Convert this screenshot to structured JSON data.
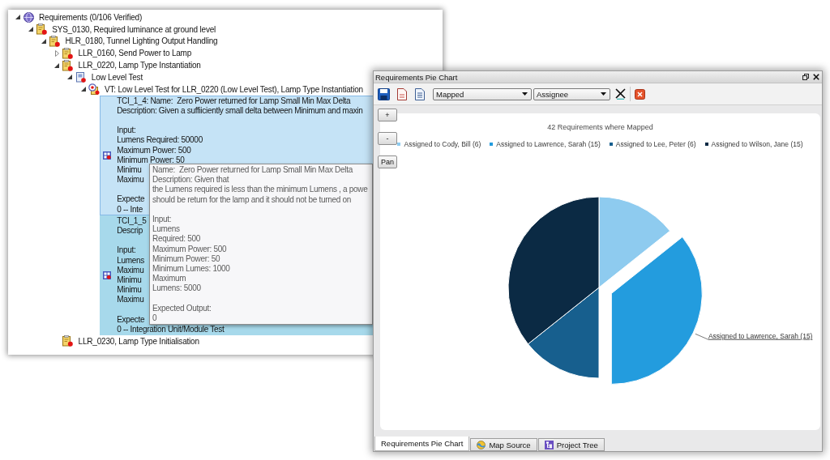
{
  "tree_window": {
    "tree": [
      {
        "label": "Requirements (0/106 Verified)",
        "kind": "root",
        "expanded": true,
        "selected": false,
        "children": [
          {
            "label": "SYS_0130, Required luminance at ground level",
            "kind": "requirement",
            "expanded": true,
            "selected": false,
            "children": [
              {
                "label": "HLR_0180, Tunnel Lighting Output Handling",
                "kind": "requirement",
                "expanded": true,
                "selected": false,
                "children": [
                  {
                    "label": "LLR_0160, Send Power to Lamp",
                    "kind": "requirement",
                    "expanded": false,
                    "selected": false
                  },
                  {
                    "label": "LLR_0220, Lamp Type Instantiation",
                    "kind": "requirement",
                    "expanded": true,
                    "selected": false,
                    "children": [
                      {
                        "label": "Low Level Test",
                        "kind": "test-group",
                        "expanded": true,
                        "selected": false,
                        "children": [
                          {
                            "label": "VT: Low Level Test for LLR_0220 (Low Level Test), Lamp Type Instantiation",
                            "kind": "verification",
                            "expanded": true,
                            "selected": false,
                            "children": [
                              {
                                "kind": "test-case",
                                "selected": false,
                                "hovered": true,
                                "paragraphs": [
                                  [
                                    "TCI_1_4: Name:  Zero Power returned for Lamp Small Min Max Delta",
                                    "Description: Given a suffiiciently small delta between Minimum and maxin"
                                  ],
                                  [
                                    "Input:",
                                    "Lumens Required: 50000",
                                    "Maximum Power: 500",
                                    "Minimum Power: 50",
                                    "Minimu",
                                    "Maximu"
                                  ],
                                  [
                                    "Expecte",
                                    "0 -- Inte"
                                  ]
                                ]
                              },
                              {
                                "kind": "test-case",
                                "selected": true,
                                "hovered": false,
                                "paragraphs": [
                                  [
                                    "TCI_1_5",
                                    "Descrip"
                                  ],
                                  [
                                    "Input:",
                                    "Lumens",
                                    "Maximu",
                                    "Minimu",
                                    "Minimu",
                                    "Maximu"
                                  ],
                                  [
                                    "Expecte",
                                    "0 -- Integration Unit/Module Test"
                                  ]
                                ]
                              }
                            ]
                          }
                        ]
                      }
                    ]
                  },
                  {
                    "label": "LLR_0230, Lamp Type Initialisation",
                    "kind": "requirement",
                    "selected": false
                  }
                ]
              }
            ]
          }
        ]
      }
    ]
  },
  "tooltip": {
    "paragraphs": [
      [
        "Name:  Zero Power returned for Lamp Small Min Max Delta",
        "Description: Given that",
        "the Lumens required is less than the minimum Lumens , a powe",
        "should be return for the lamp and it should not be turned on"
      ],
      [
        "Input:",
        "Lumens",
        "Required: 500",
        "Maximum Power: 500",
        "Minimum Power: 50",
        "Minimum Lumes: 1000",
        "Maximum",
        "Lumens: 5000"
      ],
      [
        "Expected Output:",
        "0"
      ]
    ]
  },
  "chart_window": {
    "title": "Requirements Pie Chart",
    "filters": [
      {
        "value": "Mapped"
      },
      {
        "value": "Assignee"
      }
    ],
    "tool_buttons": [
      {
        "label": "+"
      },
      {
        "label": "-"
      },
      {
        "label": "Pan"
      }
    ],
    "chart": {
      "slices": [
        {
          "color": "#8ecbef",
          "exploded": false
        },
        {
          "color": "#239cde",
          "exploded": true,
          "label": "Assigned to Lawrence, Sarah (15)"
        },
        {
          "color": "#175f8e",
          "exploded": false
        },
        {
          "color": "#0b2a44",
          "exploded": false
        }
      ],
      "chart_data": {
        "type": "pie",
        "title": "42 Requirements where Mapped",
        "legend": "top",
        "categories": [
          "Assigned to Cody, Bill (6)",
          "Assigned to Lawrence, Sarah (15)",
          "Assigned to Lee, Peter (6)",
          "Assigned to Wilson, Jane (15)"
        ],
        "values": [
          6,
          15,
          6,
          15
        ]
      }
    },
    "tabs": [
      {
        "label": "Requirements Pie Chart",
        "kind": "plain",
        "selected": true
      },
      {
        "label": "Map Source",
        "kind": "map",
        "selected": false
      },
      {
        "label": "Project Tree",
        "kind": "tree",
        "selected": false
      }
    ]
  }
}
